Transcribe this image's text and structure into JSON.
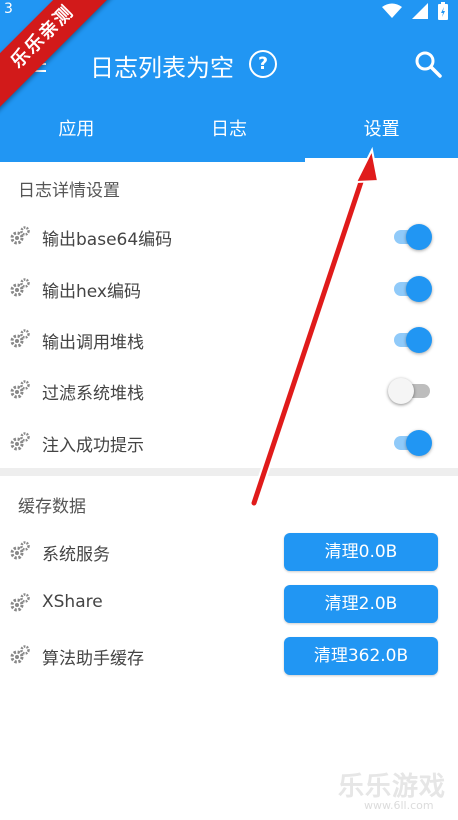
{
  "status_bar": {
    "left_text": "3"
  },
  "toolbar": {
    "title": "日志列表为空",
    "help_symbol": "?"
  },
  "tabs": [
    {
      "label": "应用",
      "active": false
    },
    {
      "label": "日志",
      "active": false
    },
    {
      "label": "设置",
      "active": true
    }
  ],
  "watermark_ribbon": "乐乐亲测",
  "log_settings": {
    "header": "日志详情设置",
    "items": [
      {
        "label": "输出base64编码",
        "enabled": true
      },
      {
        "label": "输出hex编码",
        "enabled": true
      },
      {
        "label": "输出调用堆栈",
        "enabled": true
      },
      {
        "label": "过滤系统堆栈",
        "enabled": false
      },
      {
        "label": "注入成功提示",
        "enabled": true
      }
    ]
  },
  "cache": {
    "header": "缓存数据",
    "items": [
      {
        "label": "系统服务",
        "button": "清理0.0B"
      },
      {
        "label": "XShare",
        "button": "清理2.0B"
      },
      {
        "label": "算法助手缓存",
        "button": "清理362.0B"
      }
    ]
  },
  "bottom_watermark": {
    "logo": "乐乐游戏",
    "url": "www.6ll.com"
  },
  "colors": {
    "primary": "#2196f3",
    "toggle_track_on": "#90caf9",
    "arrow": "#e01b1b"
  }
}
